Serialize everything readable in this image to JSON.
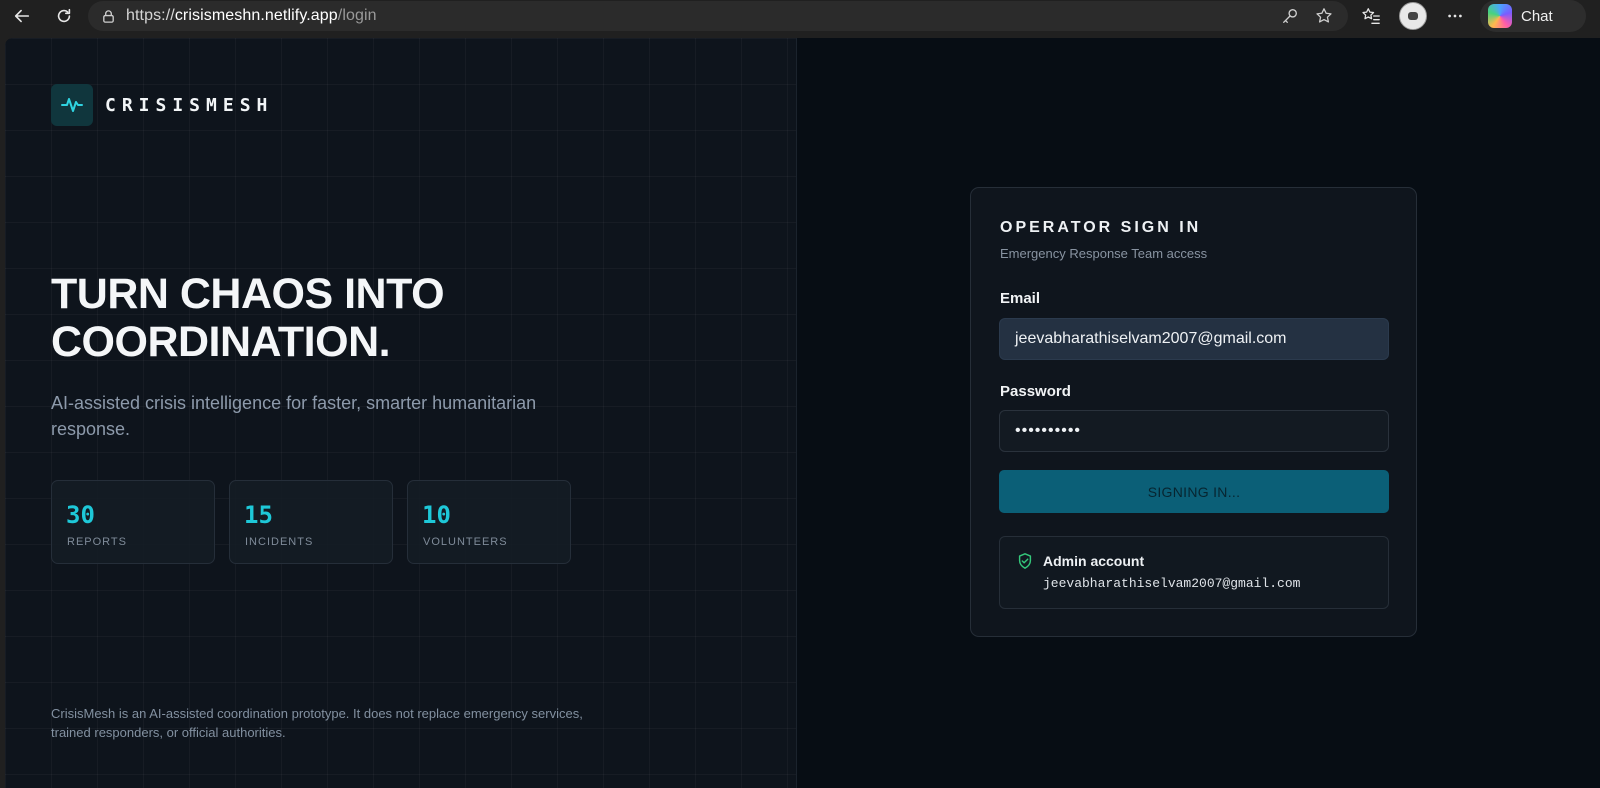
{
  "browser": {
    "url_scheme": "https://",
    "url_host": "crisismeshn.netlify.app",
    "url_path": "/login",
    "chat_label": "Chat"
  },
  "brand": {
    "name": "CRISISMESH",
    "accent_color": "#1ec8d8"
  },
  "hero": {
    "headline_line1": "TURN CHAOS INTO",
    "headline_line2": "COORDINATION.",
    "subline": "AI-assisted crisis intelligence for faster, smarter humanitarian response."
  },
  "stats": [
    {
      "value": "30",
      "label": "REPORTS"
    },
    {
      "value": "15",
      "label": "INCIDENTS"
    },
    {
      "value": "10",
      "label": "VOLUNTEERS"
    }
  ],
  "disclaimer": "CrisisMesh is an AI-assisted coordination prototype. It does not replace emergency services, trained responders, or official authorities.",
  "login": {
    "title": "OPERATOR SIGN IN",
    "subtitle": "Emergency Response Team access",
    "email_label": "Email",
    "email_value": "jeevabharathiselvam2007@gmail.com",
    "password_label": "Password",
    "password_value": "••••••••••",
    "submit_label": "SIGNING IN...",
    "admin_title": "Admin account",
    "admin_email": "jeevabharathiselvam2007@gmail.com"
  }
}
